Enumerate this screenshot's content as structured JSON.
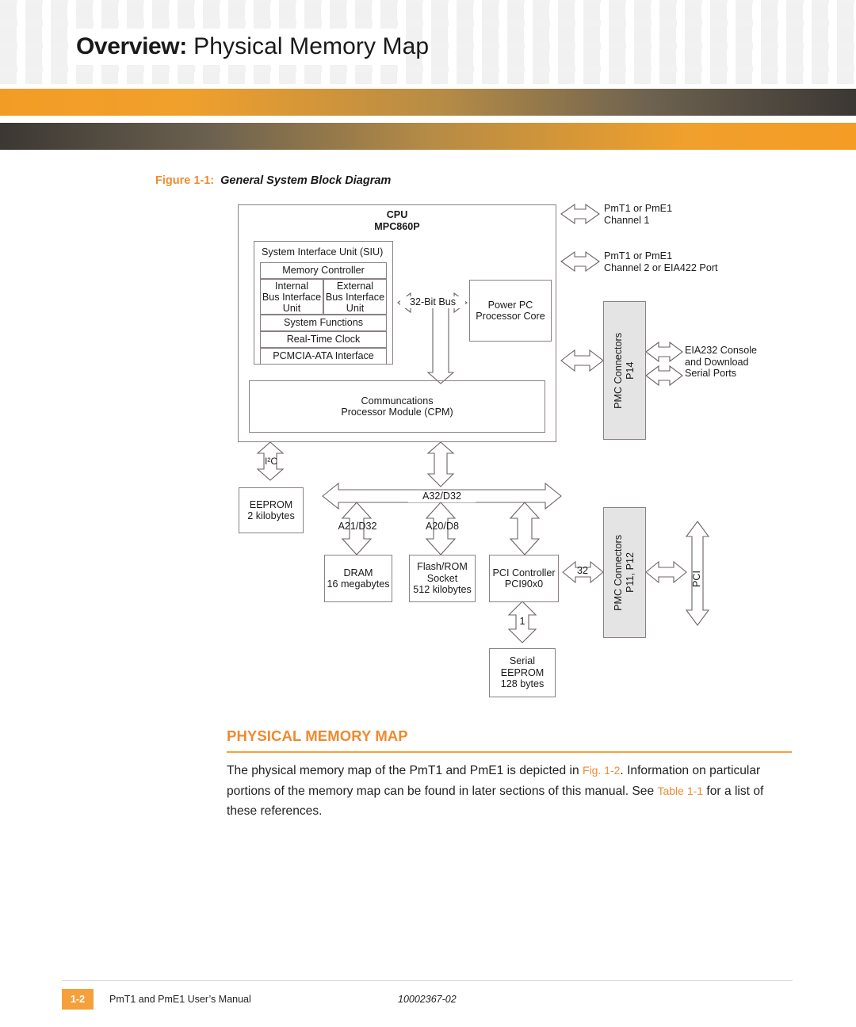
{
  "header": {
    "title_bold": "Overview:",
    "title_light": "Physical Memory Map",
    "accent_orange": "#f39c25",
    "accent_dark": "#3b3733"
  },
  "figure": {
    "number": "Figure 1-1:",
    "title": "General System Block Diagram",
    "caption_color": "#ef8b33"
  },
  "diagram": {
    "cpu": {
      "title_line1": "CPU",
      "title_line2": "MPC860P"
    },
    "siu": {
      "title": "System Interface Unit (SIU)",
      "rows": [
        "Memory Controller",
        "System Functions",
        "Real-Time Clock",
        "PCMCIA-ATA Interface"
      ],
      "internal_bus": "Internal\nBus Interface\nUnit",
      "external_bus": "External\nBus Interface\nUnit"
    },
    "bus_32bit": "32-Bit Bus",
    "power_pc_core": "Power PC\nProcessor Core",
    "cpm": "Communcations\nProcessor Module (CPM)",
    "i2c_label": "I²C",
    "eeprom": "EEPROM\n2 kilobytes",
    "bus_a32d32": "A32/D32",
    "bus_a21d32": "A21/D32",
    "bus_a20d8": "A20/D8",
    "dram": "DRAM\n16 megabytes",
    "flash_rom": "Flash/ROM\nSocket\n512 kilobytes",
    "pci_controller": "PCI Controller\nPCI90x0",
    "pci_width_32": "32",
    "serial_eeprom_width_1": "1",
    "serial_eeprom": "Serial\nEEPROM\n128 bytes",
    "pmc_p14": "PMC Connectors\nP14",
    "pmc_p11_p12": "PMC Connectors\nP11, P12",
    "pci_vertical": "PCI",
    "right_labels": {
      "channel1": "PmT1 or PmE1\nChannel 1",
      "channel2": "PmT1 or PmE1\nChannel 2 or EIA422 Port",
      "serial_ports": "EIA232 Console\nand Download\nSerial Ports"
    }
  },
  "section": {
    "heading": "PHYSICAL MEMORY MAP",
    "rule_color": "#f0a43d",
    "paragraph_part1": "The physical memory map of the PmT1 and PmE1 is depicted in ",
    "paragraph_xref1": "Fig. 1-2",
    "paragraph_part2": ". Information on particular portions of the memory map can be found in later sections of this manual. See ",
    "paragraph_xref2": "Table 1-1",
    "paragraph_part3": " for a list of these references."
  },
  "footer": {
    "page_number": "1-2",
    "manual_title": "PmT1 and PmE1 User’s Manual",
    "document_number": "10002367-02"
  }
}
